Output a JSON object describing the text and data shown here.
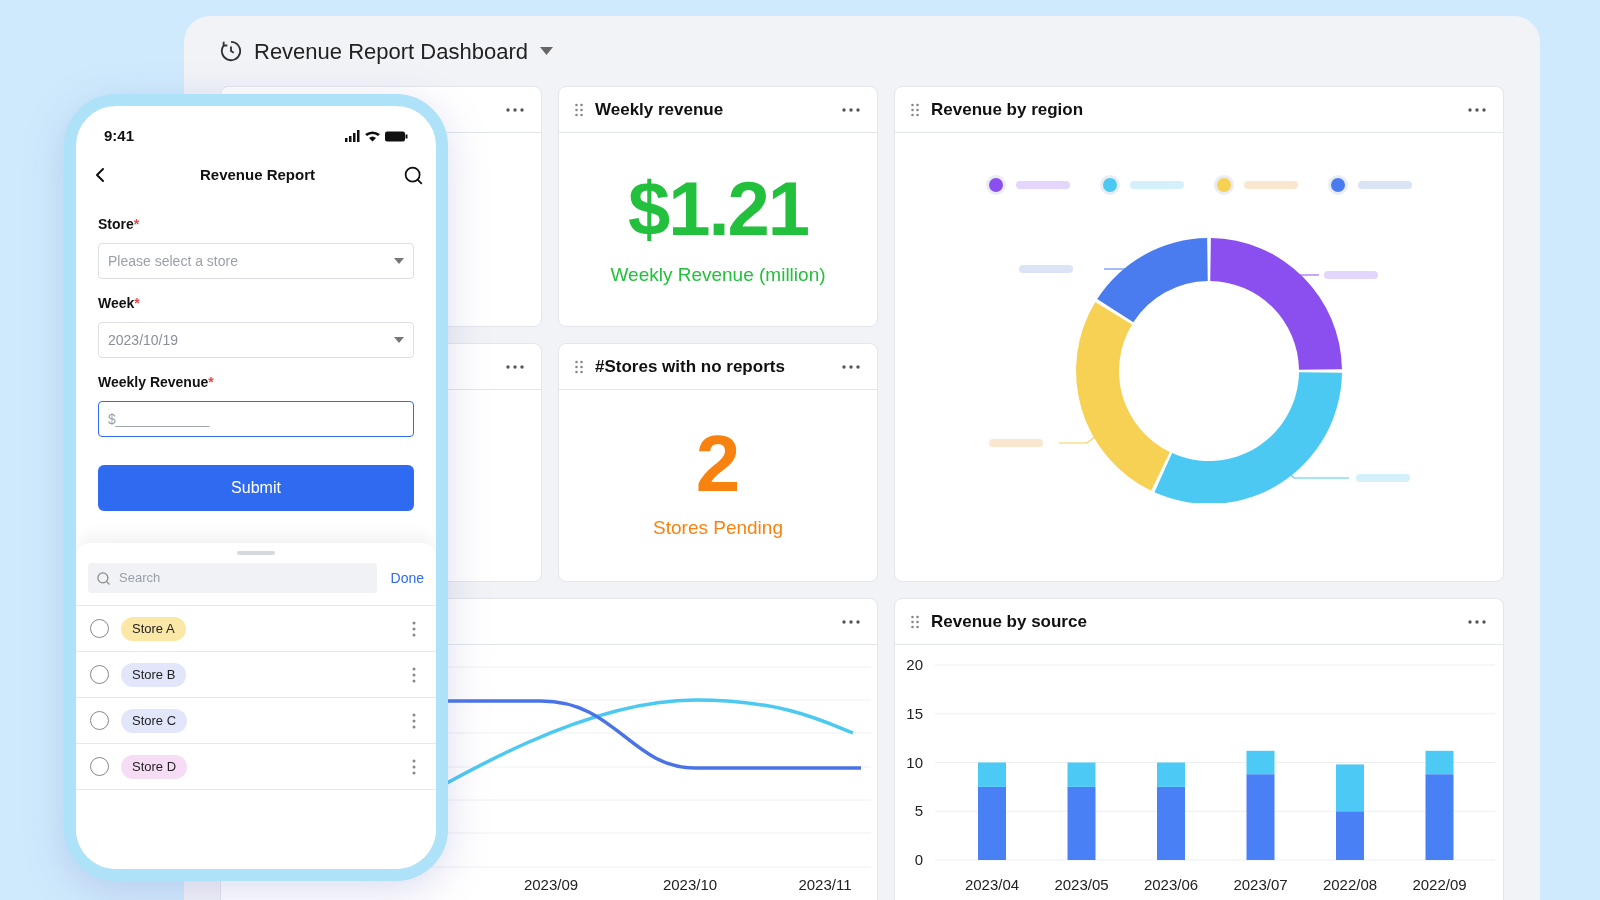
{
  "dashboard": {
    "title": "Revenue Report Dashboard"
  },
  "weekly_revenue": {
    "title": "Weekly revenue",
    "value": "$1.21",
    "caption": "Weekly Revenue (million)"
  },
  "stores_no_reports": {
    "title": "#Stores with no reports",
    "value": "2",
    "caption": "Stores Pending"
  },
  "revenue_by_region": {
    "title": "Revenue by region",
    "legend": [
      {
        "color": "#8b4ff0"
      },
      {
        "color": "#4cc9f2"
      },
      {
        "color": "#f7d154"
      },
      {
        "color": "#4a7cf0"
      }
    ]
  },
  "line_card": {
    "x_labels": [
      "2023/09",
      "2023/10",
      "2023/11"
    ]
  },
  "revenue_by_source": {
    "title": "Revenue by source",
    "chart_data": {
      "type": "bar",
      "stacked": true,
      "categories": [
        "2023/04",
        "2023/05",
        "2023/06",
        "2023/07",
        "2022/08",
        "2022/09"
      ],
      "ylim": [
        0,
        20
      ],
      "grid": true,
      "yticks": [
        0,
        5,
        10,
        15,
        20
      ],
      "series": [
        {
          "color": "#4a80f5",
          "values": [
            7.5,
            7.5,
            7.5,
            8.8,
            5.0,
            8.8
          ]
        },
        {
          "color": "#4cc9f5",
          "values": [
            2.5,
            2.5,
            2.5,
            2.4,
            4.8,
            2.4
          ]
        }
      ]
    }
  },
  "phone": {
    "time": "9:41",
    "title": "Revenue Report",
    "fields": [
      {
        "label": "Store",
        "mark": "*",
        "kind": "select",
        "placeholder": "Please select a store",
        "focused": false
      },
      {
        "label": "Week",
        "mark": "*",
        "kind": "select",
        "value": "2023/10/19",
        "focused": false
      },
      {
        "label": "Weekly Revenue",
        "mark": "*",
        "kind": "input",
        "placeholder": "$____________",
        "focused": true
      }
    ],
    "submit": "Submit",
    "sheet": {
      "search_placeholder": "Search",
      "done": "Done",
      "stores": [
        {
          "name": "Store A",
          "color": "#fbe7a6",
          "selected": false
        },
        {
          "name": "Store B",
          "color": "#e1e6fb",
          "selected": false
        },
        {
          "name": "Store C",
          "color": "#e1e6fb",
          "selected": false
        },
        {
          "name": "Store D",
          "color": "#f7dcf5",
          "selected": false
        }
      ]
    }
  }
}
